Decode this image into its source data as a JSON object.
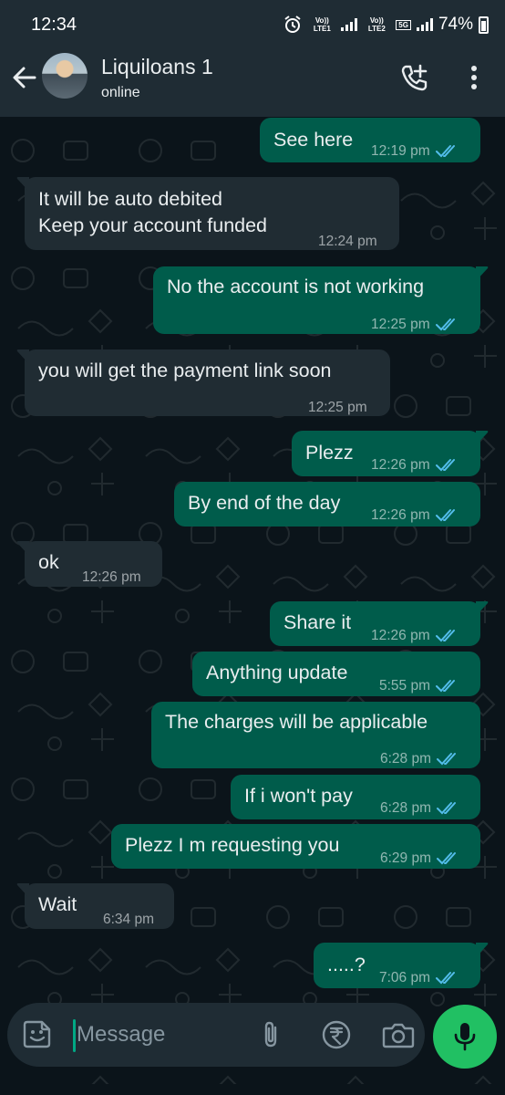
{
  "status_bar": {
    "time": "12:34",
    "sim1_label": "Vo)) LTE1",
    "sim2_label": "Vo)) LTE2",
    "network": "5G",
    "battery": "74%"
  },
  "header": {
    "contact_name": "Liquiloans 1",
    "contact_status": "online"
  },
  "messages": [
    {
      "dir": "out",
      "text": "See here",
      "time": "12:19 pm",
      "read": true
    },
    {
      "dir": "in",
      "text": "It will be auto debited",
      "text2": "Keep your account funded",
      "time": "12:24 pm"
    },
    {
      "dir": "out",
      "text": "No the account is not working",
      "time": "12:25 pm",
      "read": true
    },
    {
      "dir": "in",
      "text": "you will get the payment link soon",
      "time": "12:25 pm"
    },
    {
      "dir": "out",
      "text": "Plezz",
      "time": "12:26 pm",
      "read": true
    },
    {
      "dir": "out",
      "text": "By end of the day",
      "time": "12:26 pm",
      "read": true
    },
    {
      "dir": "in",
      "text": "ok",
      "time": "12:26 pm"
    },
    {
      "dir": "out",
      "text": "Share it",
      "time": "12:26 pm",
      "read": true
    },
    {
      "dir": "out",
      "text": "Anything update",
      "time": "5:55 pm",
      "read": true
    },
    {
      "dir": "out",
      "text": "The charges will be applicable",
      "time": "6:28 pm",
      "read": true
    },
    {
      "dir": "out",
      "text": "If i won't pay",
      "time": "6:28 pm",
      "read": true
    },
    {
      "dir": "out",
      "text": "Plezz I m requesting you",
      "time": "6:29 pm",
      "read": true
    },
    {
      "dir": "in",
      "text": "Wait",
      "time": "6:34 pm"
    },
    {
      "dir": "out",
      "text": ".....?",
      "time": "7:06 pm",
      "read": true
    }
  ],
  "composer": {
    "placeholder": "Message"
  },
  "colors": {
    "outgoing_bubble": "#005c4b",
    "incoming_bubble": "#202c33",
    "read_ticks": "#53bdeb",
    "mic_button": "#21c063"
  },
  "icons": [
    "back-arrow-icon",
    "add-call-icon",
    "more-options-icon",
    "emoji-sticker-icon",
    "attach-icon",
    "rupee-payment-icon",
    "camera-icon",
    "mic-icon",
    "read-ticks-icon"
  ]
}
